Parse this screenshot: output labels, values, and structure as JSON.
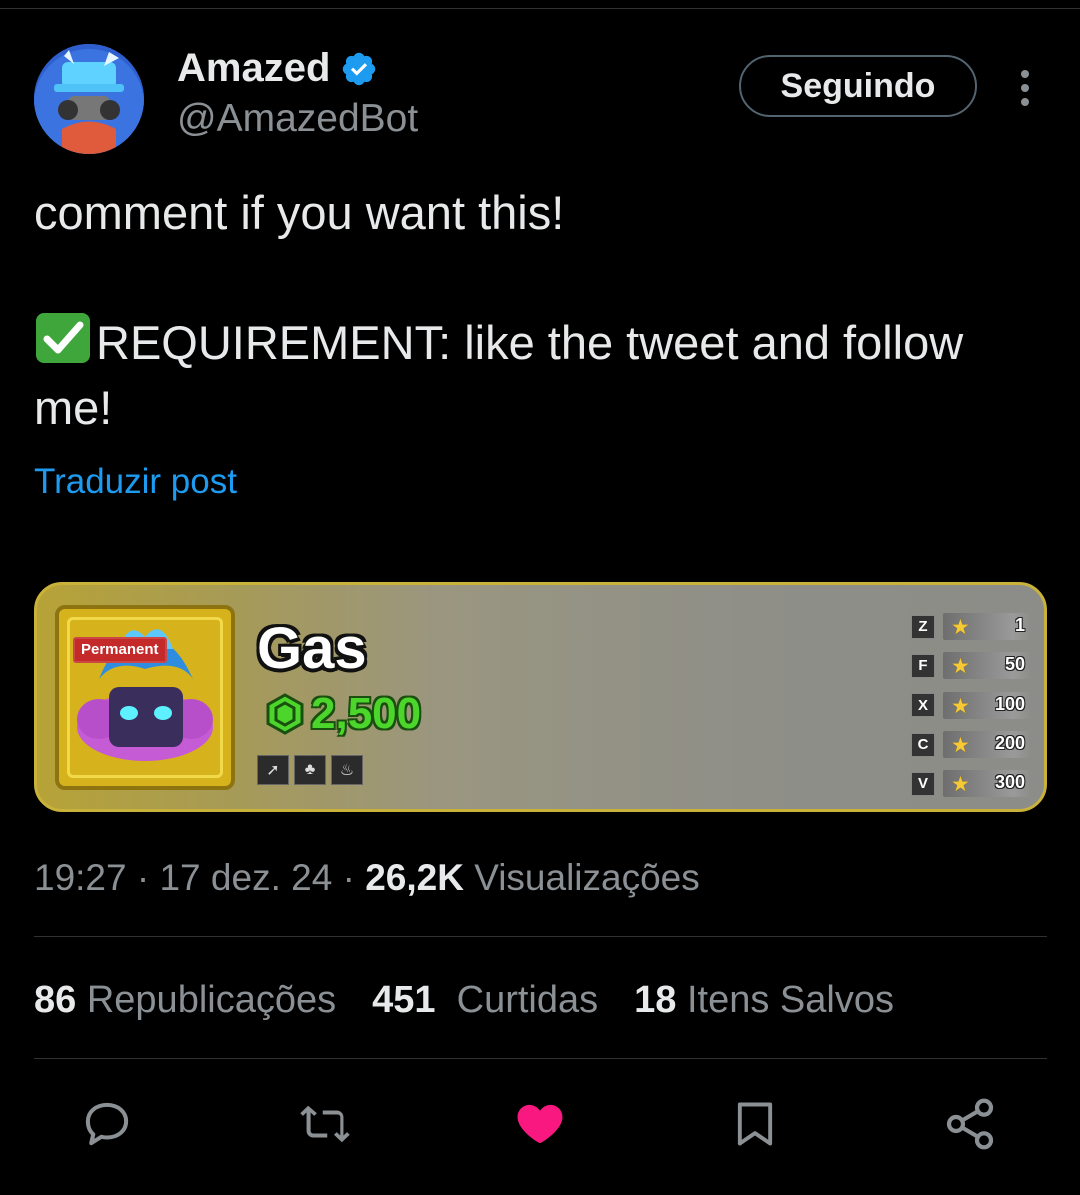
{
  "author": {
    "display_name": "Amazed",
    "handle": "@AmazedBot",
    "verified": true,
    "verified_color": "#1d9bf0",
    "follow_button_label": "Seguindo",
    "more_icon": "more-vertical-icon"
  },
  "post": {
    "line1": "comment if you want this!",
    "line2_emoji": "check-mark-button-icon",
    "line2": "REQUIREMENT: like the tweet and follow",
    "line3": "me!",
    "translate_link": "Traduzir post"
  },
  "media": {
    "tag": "Permanent",
    "item_name": "Gas",
    "price": "2,500",
    "price_color": "#4cd62b",
    "moves": [
      {
        "key": "Z",
        "level": "1"
      },
      {
        "key": "F",
        "level": "50"
      },
      {
        "key": "X",
        "level": "100"
      },
      {
        "key": "C",
        "level": "200"
      },
      {
        "key": "V",
        "level": "300"
      }
    ]
  },
  "meta": {
    "time": "19:27",
    "date": "17 dez. 24",
    "views_count": "26,2K",
    "views_label": "Visualizações",
    "sep": "·"
  },
  "stats": {
    "reposts_count": "86",
    "reposts_label": "Republicações",
    "likes_count": "451",
    "likes_label": "Curtidas",
    "saves_count": "18",
    "saves_label": "Itens Salvos"
  },
  "actions": {
    "reply_icon": "reply-icon",
    "repost_icon": "repost-icon",
    "like_icon": "heart-icon",
    "like_active_color": "#f91880",
    "bookmark_icon": "bookmark-icon",
    "share_icon": "share-icon"
  }
}
